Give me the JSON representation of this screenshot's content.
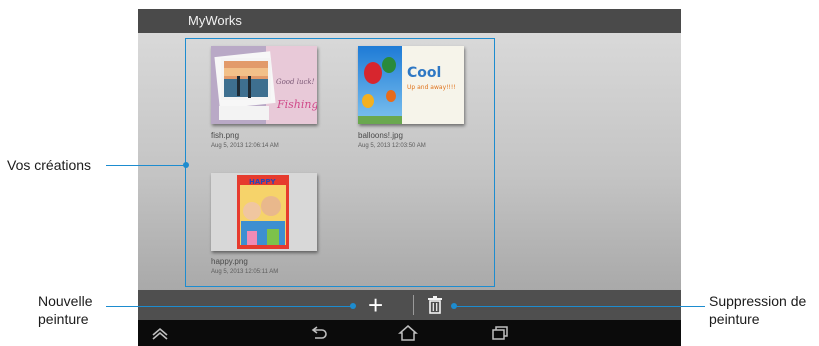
{
  "app": {
    "title": "MyWorks"
  },
  "gallery": {
    "items": [
      {
        "name": "fish.png",
        "date": "Aug 5, 2013 12:06:14 AM",
        "caption": "Good luck!",
        "caption2": "Fishing"
      },
      {
        "name": "balloons!.jpg",
        "date": "Aug 5, 2013 12:03:50 AM",
        "caption": "Cool",
        "caption2": "Up and away!!!!"
      },
      {
        "name": "happy.png",
        "date": "Aug 5, 2013 12:05:11 AM",
        "caption": "HAPPY"
      }
    ]
  },
  "actions": {
    "add_icon": "plus-icon",
    "delete_icon": "trash-icon"
  },
  "nav": {
    "icons": [
      "collapse-icon",
      "back-icon",
      "home-icon",
      "recent-apps-icon"
    ]
  },
  "callouts": {
    "creations": "Vos créations",
    "new_line1": "Nouvelle",
    "new_line2": "peinture",
    "delete_line1": "Suppression de",
    "delete_line2": "peinture"
  },
  "colors": {
    "accent": "#1d8ccf",
    "titlebar": "#4a4a4a",
    "actionbar": "#4f4f4f"
  }
}
